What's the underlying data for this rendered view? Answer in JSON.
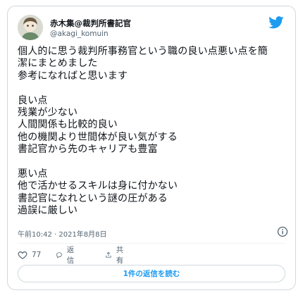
{
  "user": {
    "display_name": "赤木集@裁判所書記官",
    "handle": "@akagi_komuin",
    "avatar_icon": "user-avatar-icon"
  },
  "brand_icon": "twitter-bird-icon",
  "colors": {
    "brand": "#1d9bf0",
    "text": "#0f1419",
    "muted": "#536471",
    "border": "#cfd9de"
  },
  "tweet_lines": [
    "個人的に思う裁判所事務官という職の良い点悪い点を簡",
    "潔にまとめました",
    "参考になればと思います",
    "",
    "良い点",
    "残業が少ない",
    "人間関係も比較的良い",
    "他の機関より世間体が良い気がする",
    "書記官から先のキャリアも豊富",
    "",
    "悪い点",
    "他で活かせるスキルは身に付かない",
    "書記官になれという謎の圧がある",
    "過誤に厳しい"
  ],
  "timestamp": "午前10:42 · 2021年8月8日",
  "actions": {
    "like_count": "77",
    "reply_label": "返信",
    "share_label": "共有"
  },
  "read_replies_label": "1件の返信を読む"
}
